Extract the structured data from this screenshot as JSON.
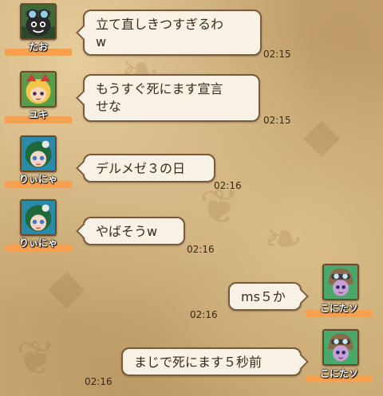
{
  "messages": [
    {
      "name": "たお",
      "text": "立て直しきつすぎるわ\nw",
      "time": "02:15",
      "avatar_icon": "goggle-monster-avatar-icon"
    },
    {
      "name": "ユキ",
      "text": "もうすぐ死にます宣言\nせな",
      "time": "02:15",
      "avatar_icon": "blonde-girl-avatar-icon"
    },
    {
      "name": "りぃにゃ",
      "text": "デルメゼ３の日",
      "time": "02:16",
      "avatar_icon": "green-hair-girl-avatar-icon"
    },
    {
      "name": "りぃにゃ",
      "text": "やばそうw",
      "time": "02:16",
      "avatar_icon": "green-hair-girl-avatar-icon"
    },
    {
      "name": "こにたソ",
      "text": "ms５か",
      "time": "02:16",
      "avatar_icon": "helmet-girl-avatar-icon"
    },
    {
      "name": "こにたソ",
      "text": "まじで死にます５秒前",
      "time": "02:16",
      "avatar_icon": "helmet-girl-avatar-icon"
    }
  ],
  "colors": {
    "background": "#c8a872",
    "bubble": "#f7f1e6",
    "bubble_border": "#7a5a3a",
    "name_highlight": "#f7a14f"
  }
}
